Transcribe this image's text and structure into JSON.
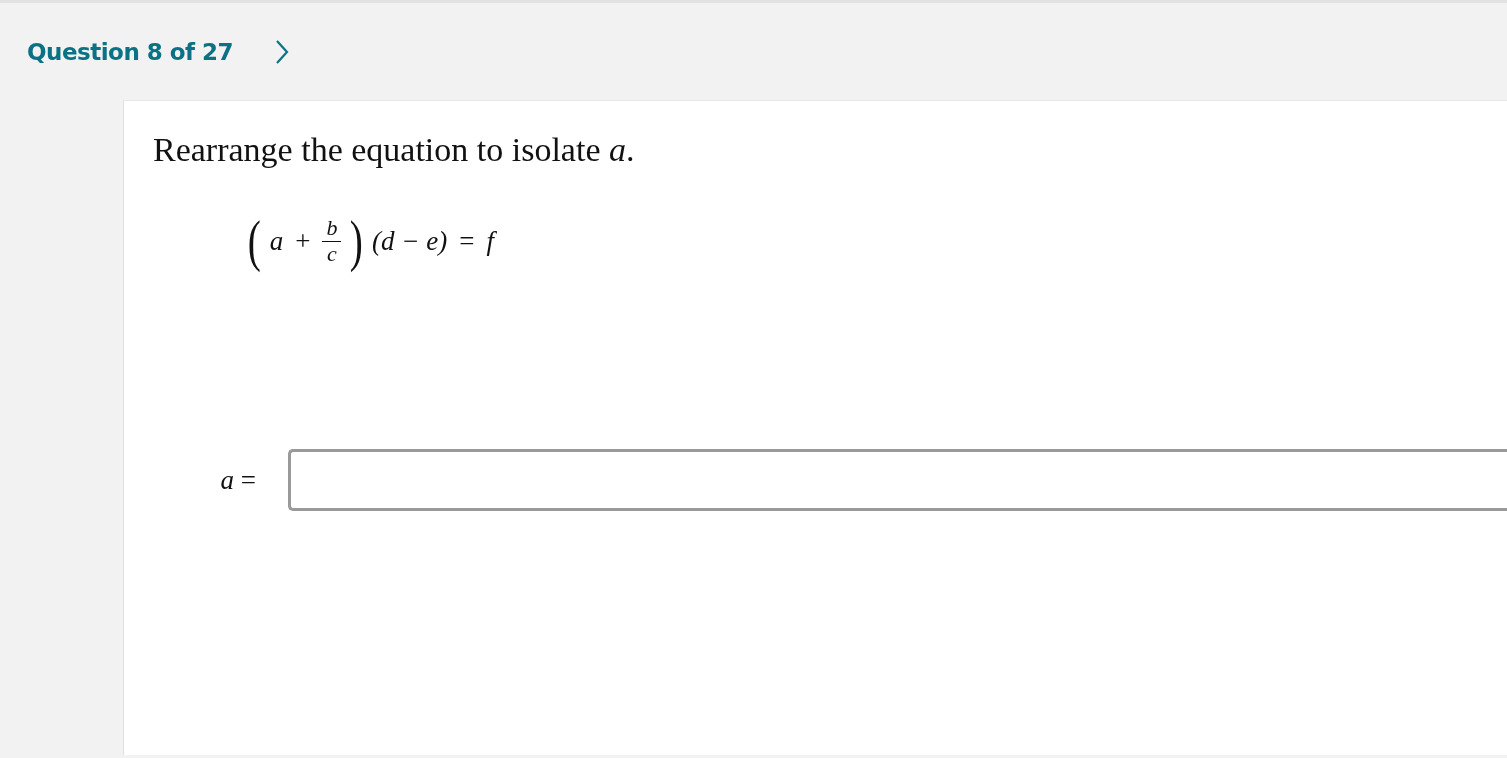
{
  "header": {
    "question_counter": "Question 8 of 27"
  },
  "question": {
    "prompt": "Rearrange the equation to isolate *a*.",
    "equation": {
      "open_paren": "(",
      "term": "a",
      "plus": "+",
      "numerator": "b",
      "denominator": "c",
      "close_paren": ")",
      "factor": "(d − e)",
      "equals": "=",
      "rhs": "f"
    },
    "answer": {
      "label": "*a* ="
    }
  }
}
